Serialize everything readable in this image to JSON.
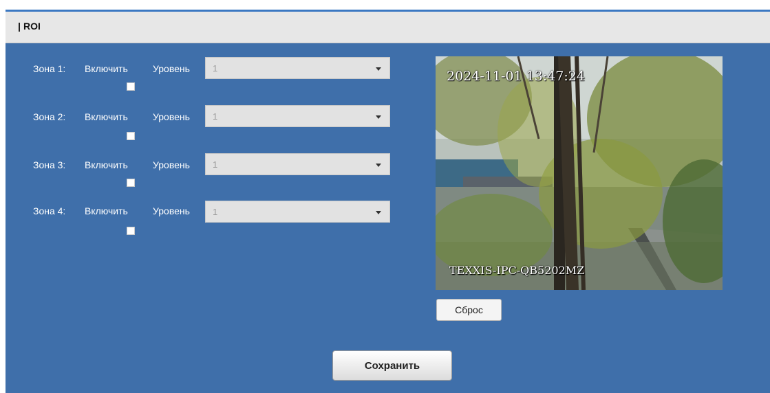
{
  "header": {
    "title": "ROI"
  },
  "zones": [
    {
      "name": "Зона 1:",
      "enable_label": "Включить",
      "enabled": false,
      "level_label": "Уровень",
      "level": "1"
    },
    {
      "name": "Зона 2:",
      "enable_label": "Включить",
      "enabled": false,
      "level_label": "Уровень",
      "level": "1"
    },
    {
      "name": "Зона 3:",
      "enable_label": "Включить",
      "enabled": false,
      "level_label": "Уровень",
      "level": "1"
    },
    {
      "name": "Зона 4:",
      "enable_label": "Включить",
      "enabled": false,
      "level_label": "Уровень",
      "level": "1"
    }
  ],
  "preview": {
    "timestamp": "2024-11-01 13:47:24",
    "camera_name": "TEXXIS-IPC-QB5202MZ"
  },
  "buttons": {
    "reset": "Сброс",
    "save": "Сохранить"
  },
  "colors": {
    "panel_bg": "#3f6faa",
    "header_bg": "#e7e7e7",
    "select_bg": "#e2e2e2"
  },
  "icons": {
    "select_arrow": "chevron-down-icon"
  }
}
